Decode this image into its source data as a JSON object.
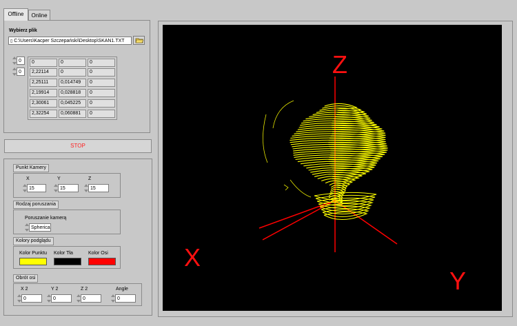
{
  "tabs": [
    {
      "label": "Offline",
      "active": true
    },
    {
      "label": "Online",
      "active": false
    }
  ],
  "file": {
    "label": "Wybierz plik",
    "path": "C:\\Users\\Kacper Szczepański\\Desktop\\SKAN1.TXT"
  },
  "table": {
    "row_index": "0",
    "col_index": "0",
    "rows": [
      [
        "0",
        "0",
        "0"
      ],
      [
        "2,22114",
        "0",
        "0"
      ],
      [
        "2,25111",
        "0,014749",
        "0"
      ],
      [
        "2,19914",
        "0,028818",
        "0"
      ],
      [
        "2,30061",
        "0,045225",
        "0"
      ],
      [
        "2,32254",
        "0,060881",
        "0"
      ]
    ]
  },
  "stop_label": "STOP",
  "camera": {
    "title": "Punkt  Kamery",
    "x_label": "X",
    "x_value": "15",
    "y_label": "Y",
    "y_value": "15",
    "z_label": "Z",
    "z_value": "15"
  },
  "motion": {
    "title": "Rodzaj poruszania",
    "label": "Poruszanie kamerą",
    "value": "Spherica"
  },
  "colors": {
    "title": "Kolory podglądu",
    "point_label": "Kolor Punktu",
    "bg_label": "Kolor Tła",
    "axis_label": "Kolor Osi",
    "point_color": "#ffff00",
    "bg_color": "#000000",
    "axis_color": "#ff0000"
  },
  "rotation": {
    "title": "Obrót osi",
    "x2_label": "X 2",
    "x2_value": "0",
    "y2_label": "Y 2",
    "y2_value": "0",
    "z2_label": "Z 2",
    "z2_value": "0",
    "angle_label": "Angle",
    "angle_value": "0"
  },
  "view": {
    "axis_z": "Z",
    "axis_x": "X",
    "axis_y": "Y",
    "point_color": "#ffff00",
    "axis_color": "#ff0000"
  }
}
